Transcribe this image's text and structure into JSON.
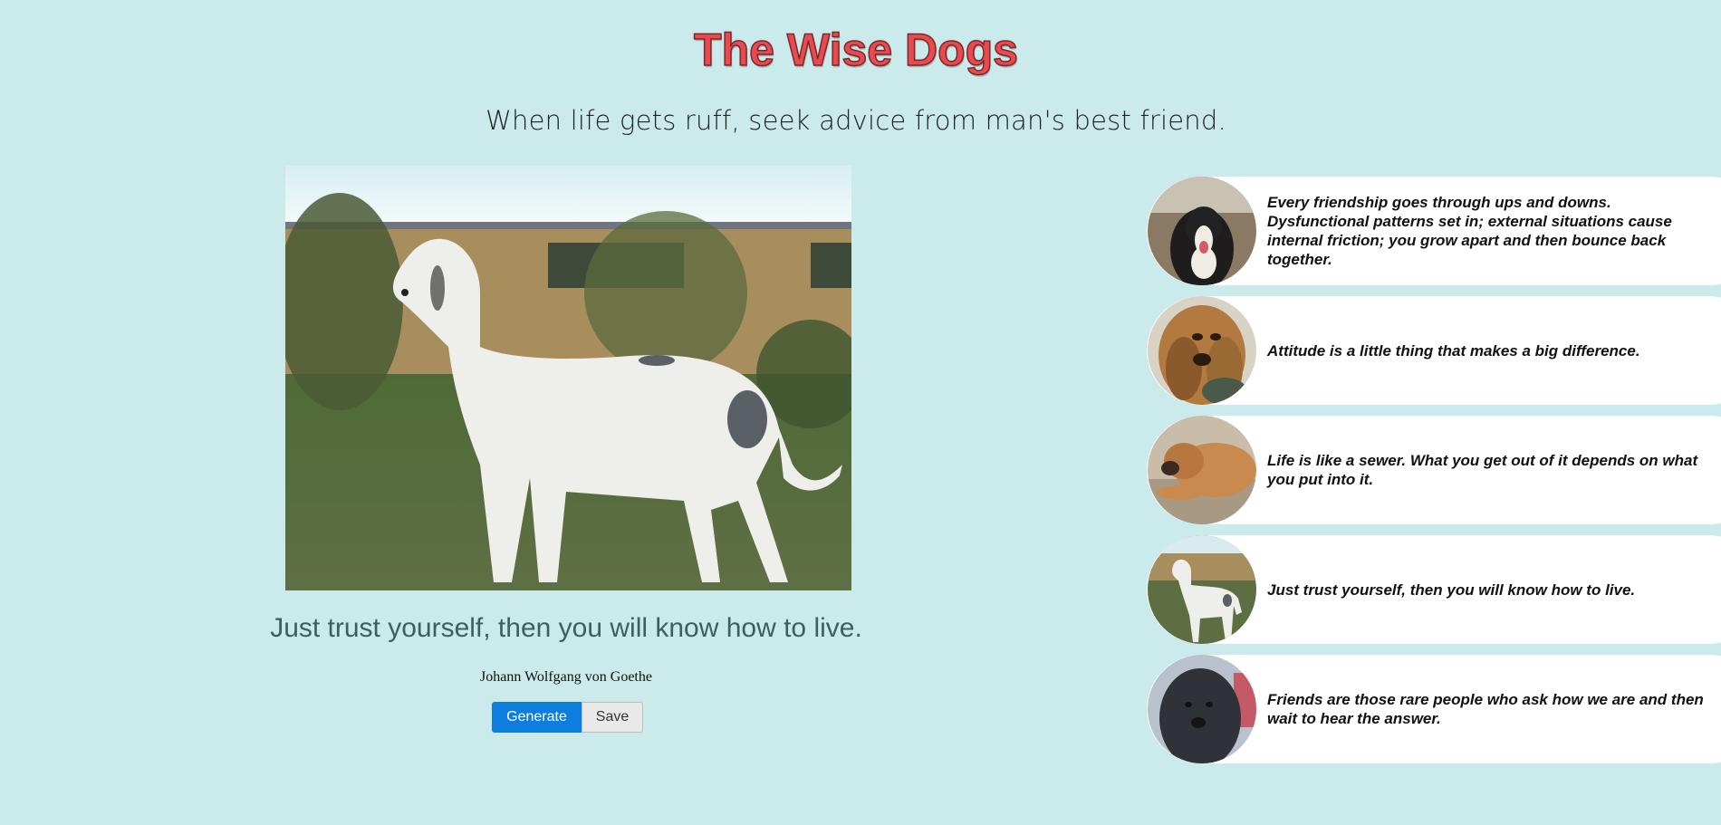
{
  "header": {
    "title": "The Wise Dogs",
    "subtitle": "When life gets ruff, seek advice from man's best friend."
  },
  "main": {
    "quote": "Just trust yourself, then you will know how to live.",
    "author": "Johann Wolfgang von Goethe",
    "generate_label": "Generate",
    "save_label": "Save"
  },
  "sidebar": {
    "cards": [
      {
        "quote": "Every friendship goes through ups and downs. Dysfunctional patterns set in; external situations cause internal friction; you grow apart and then bounce back together."
      },
      {
        "quote": "Attitude is a little thing that makes a big difference."
      },
      {
        "quote": "Life is like a sewer. What you get out of it depends on what you put into it."
      },
      {
        "quote": "Just trust yourself, then you will know how to live."
      },
      {
        "quote": "Friends are those rare people who ask how we are and then wait to hear the answer."
      }
    ]
  },
  "colors": {
    "background": "#cbeaec",
    "title": "#e84a4f",
    "generate_button": "#0d7de0",
    "quote_text": "#3c5f60"
  }
}
